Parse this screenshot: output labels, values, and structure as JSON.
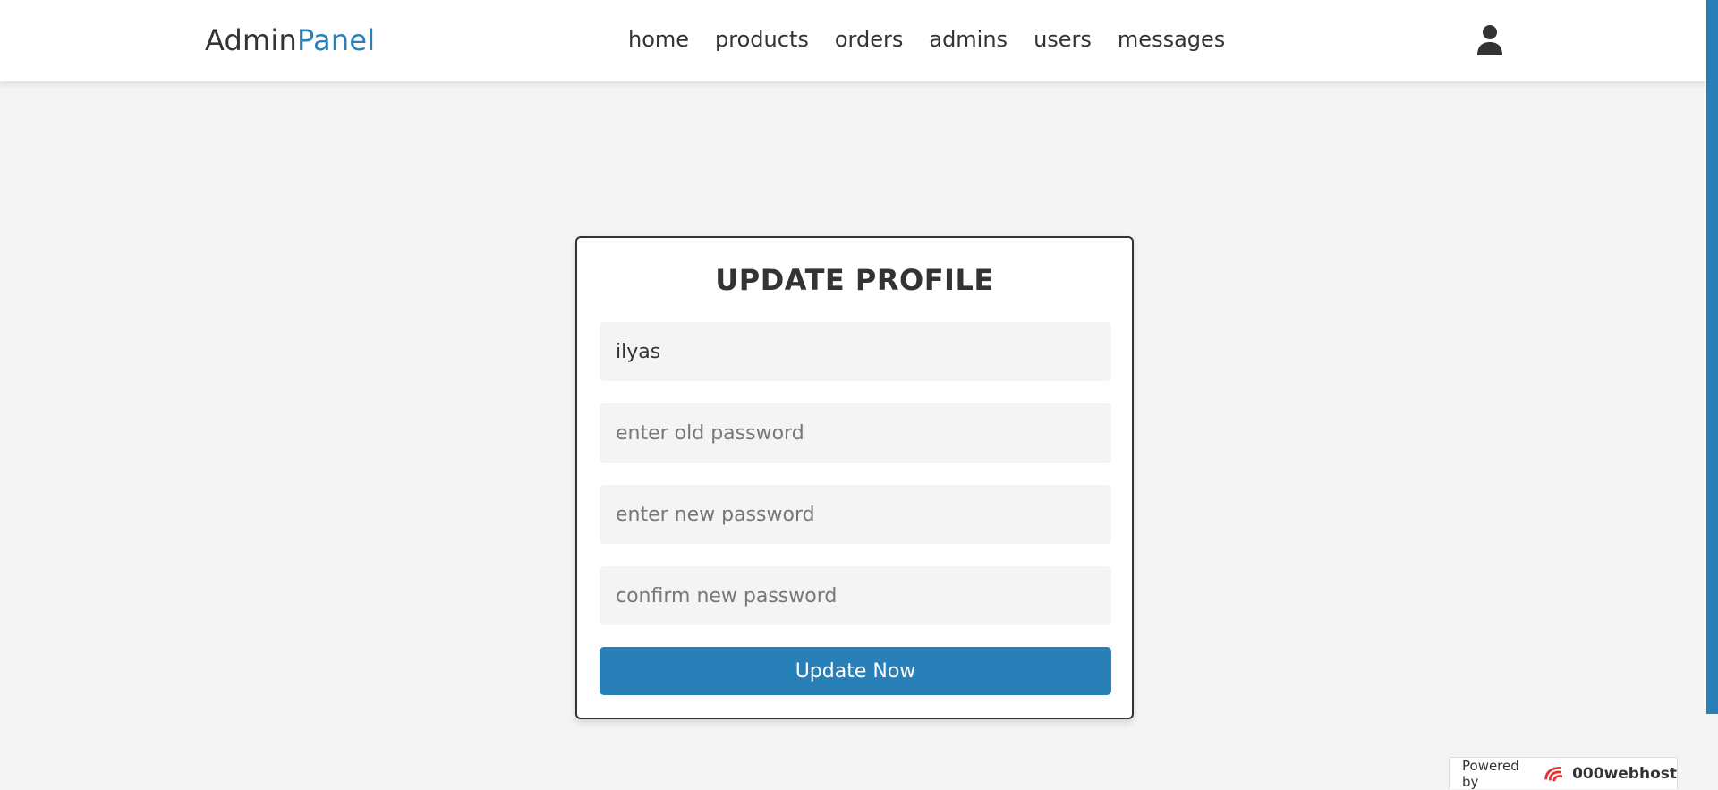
{
  "header": {
    "logo": {
      "part1": "Admin",
      "part2": "Panel"
    },
    "nav": [
      "home",
      "products",
      "orders",
      "admins",
      "users",
      "messages"
    ],
    "user_icon": "user-icon"
  },
  "form": {
    "title": "UPDATE PROFILE",
    "name_value": "ilyas",
    "old_password_placeholder": "enter old password",
    "new_password_placeholder": "enter new password",
    "confirm_password_placeholder": "confirm new password",
    "submit_label": "Update Now"
  },
  "footer": {
    "powered_label": "Powered by",
    "brand": "000webhost"
  },
  "colors": {
    "accent": "#2980b9",
    "background": "#f4f4f4",
    "text": "#333333"
  }
}
